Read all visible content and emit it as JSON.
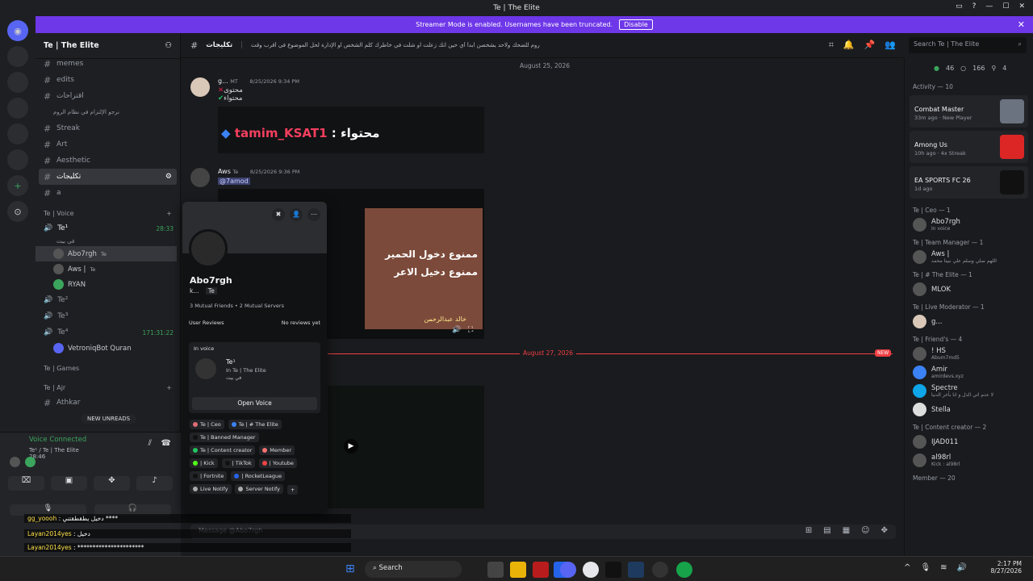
{
  "window": {
    "title": "Te | The Elite"
  },
  "banner": {
    "text": "Streamer Mode is enabled. Usernames have been truncated.",
    "button": "Disable"
  },
  "server": {
    "name": "Te | The Elite"
  },
  "channels": [
    {
      "name": "memes",
      "icon": "#"
    },
    {
      "name": "edits",
      "icon": "#"
    },
    {
      "name": "اقتراحات",
      "icon": "#"
    },
    {
      "name": "نرجو الإلتزام في نظام الروم",
      "icon": ""
    },
    {
      "name": "Streak",
      "icon": "#"
    },
    {
      "name": "Art",
      "icon": "#"
    },
    {
      "name": "Aesthetic",
      "icon": "#"
    },
    {
      "name": "تكليجات",
      "icon": "#",
      "active": true
    },
    {
      "name": "a",
      "icon": "#"
    }
  ],
  "voice_category": {
    "label": "Te | Voice"
  },
  "voice_channels": [
    {
      "name": "Te¹",
      "time": "28:33",
      "sub": "في بيت"
    },
    {
      "name": "Te²",
      "time": ""
    },
    {
      "name": "Te³",
      "time": ""
    },
    {
      "name": "Te⁴",
      "time": "171:31:22"
    }
  ],
  "voice_users": [
    "Abo7rgh",
    "Aws |",
    "RYAN",
    "VetroniqBot Quran"
  ],
  "voice_user_tag": "Te",
  "categories": {
    "games": "Te | Games",
    "ajr": "Te | Ajr"
  },
  "ajr_channel": "Athkar",
  "new_unreads": "NEW UNREADS",
  "voice_panel": {
    "status": "Voice Connected",
    "location": "Te¹ / Te | The Elite",
    "time": "28:46"
  },
  "channel_header": {
    "name": "تكليجات",
    "topic": "روم للضحك ولاحد يشخصن ابدأ أي حين انك زعلت او شلت في خاطرك كلم الشخص او الإدارة لحل الموضوع في أقرب وقت"
  },
  "search": {
    "placeholder": "Search Te | The Elite"
  },
  "chat": {
    "date1": "August 25, 2026",
    "msg1": {
      "user": "g...",
      "tag": "MT",
      "time": "8/25/2026 9:34 PM",
      "line1": "محتوى",
      "line2": "محتواء"
    },
    "quote": {
      "user": "tamim_KSAT1",
      "text": ": محتواء"
    },
    "msg2": {
      "user": "Aws",
      "tag": "Te",
      "time": "8/25/2026 9:36 PM",
      "mention": "@7amod"
    },
    "video_text_1": "ممنوع دخول الحمير",
    "video_text_2": "ممنوع دخيل الاعر",
    "video_caption": "خالد عبدالرحمن",
    "new_sep": "August 27, 2026",
    "new_badge": "NEW"
  },
  "profile": {
    "name": "Abo7rgh",
    "short": "k...",
    "tag": "Te",
    "mutual_friends": "3 Mutual Friends",
    "mutual_servers": "2 Mutual Servers",
    "reviews_label": "User Reviews",
    "reviews_value": "No reviews yet",
    "in_voice": "In voice",
    "voice_channel": "Te¹",
    "voice_server": "In Te | The Elite",
    "voice_sub": "في بيت",
    "open_voice": "Open Voice",
    "roles": [
      {
        "name": "Te | Ceo",
        "color": "#e06c75"
      },
      {
        "name": "Te | # The Elite",
        "color": "#3b82f6"
      },
      {
        "name": "Te | Banned Manager",
        "color": "#111"
      },
      {
        "name": "Te | Content creator",
        "color": "#22c55e"
      },
      {
        "name": "Member",
        "color": "#f87171"
      },
      {
        "name": "| Kick",
        "color": "#53fc18"
      },
      {
        "name": "| TikTok",
        "color": "#111"
      },
      {
        "name": "| Youtube",
        "color": "#ef4444"
      },
      {
        "name": "| Fortnite",
        "color": "#111"
      },
      {
        "name": "| RocketLeague",
        "color": "#2563eb"
      },
      {
        "name": "Live Notify",
        "color": "#aaa"
      },
      {
        "name": "Server Notify",
        "color": "#aaa"
      }
    ]
  },
  "members_top": {
    "online": "46",
    "idle": "166",
    "other": "4"
  },
  "activity": {
    "label": "Activity — 10"
  },
  "activities": [
    {
      "title": "Combat Master",
      "sub": "33m ago · New Player",
      "color": "#6b7280"
    },
    {
      "title": "Among Us",
      "sub": "10h ago · 4x Streak",
      "color": "#dc2626"
    },
    {
      "title": "EA SPORTS FC 26",
      "sub": "1d ago",
      "color": "#111"
    }
  ],
  "member_groups": [
    {
      "header": "Te | Ceo — 1",
      "members": [
        {
          "name": "Abo7rgh",
          "sub": "In voice",
          "color": "#3ba55d"
        }
      ]
    },
    {
      "header": "Te | Team Manager — 1",
      "members": [
        {
          "name": "Aws |",
          "sub": "اللهم صلي وسلم علي نبينا محمد",
          "color": "#e6e6e6"
        }
      ]
    },
    {
      "header": "Te | # The Elite — 1",
      "members": [
        {
          "name": "MLOK",
          "sub": "",
          "color": "#e6e6e6"
        }
      ]
    },
    {
      "header": "Te | Live Moderator — 1",
      "members": [
        {
          "name": "g...",
          "sub": "",
          "color": "#e6e6e6"
        }
      ]
    },
    {
      "header": "Te | Friend's — 4",
      "members": [
        {
          "name": "! HS",
          "sub": "Abum7md5",
          "color": "#e6e6e6"
        },
        {
          "name": "Amir",
          "sub": "amirdevs.xyz",
          "color": "#e6e6e6"
        },
        {
          "name": "Spectre",
          "sub": "لا عدم اتي الذل و انا بأخر الدنيا",
          "color": "#e6e6e6"
        },
        {
          "name": "Stella",
          "sub": "",
          "color": "#e6e6e6"
        }
      ]
    },
    {
      "header": "Te | Content creator — 2",
      "members": [
        {
          "name": "IJAD011",
          "sub": "",
          "color": "#e6e6e6"
        },
        {
          "name": "al98rl",
          "sub": "Kick : al98rl",
          "color": "#e6e6e6"
        }
      ]
    },
    {
      "header": "Member — 20",
      "members": []
    }
  ],
  "composer": {
    "placeholder": "Message @Abo7rgh"
  },
  "overlay": [
    {
      "user": "gg_yoooh",
      "text": ": دخيل يطقطقتني ****"
    },
    {
      "user": "Layan2014yes",
      "text": ": دخيل"
    },
    {
      "user": "Layan2014yes",
      "text": ": **********************"
    }
  ],
  "taskbar": {
    "search": "Search",
    "time": "2:17 PM",
    "date": "8/27/2026"
  }
}
